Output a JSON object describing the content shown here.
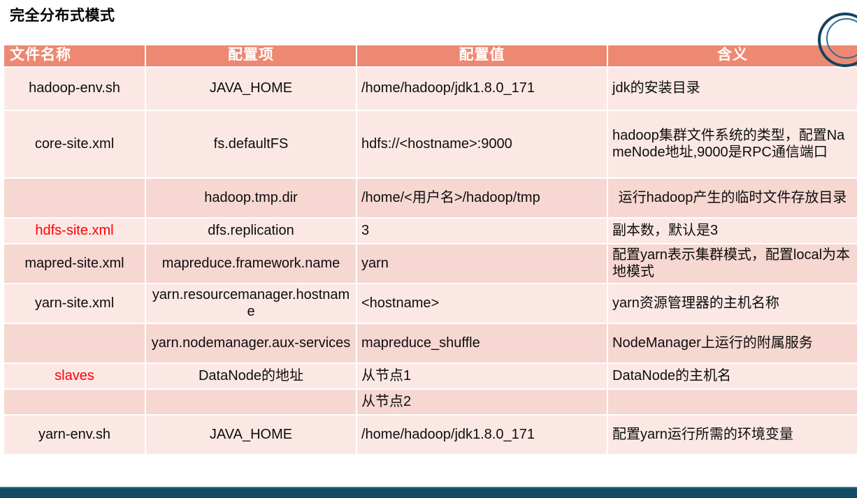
{
  "title": "完全分布式模式",
  "table": {
    "headers": [
      {
        "label": "文件名称",
        "align": "left"
      },
      {
        "label": "配置项",
        "align": "center"
      },
      {
        "label": "配置值",
        "align": "center"
      },
      {
        "label": "含义",
        "align": "center"
      }
    ],
    "rows": [
      {
        "shade": "a",
        "file": "hadoop-env.sh",
        "item": "JAVA_HOME",
        "value": "/home/hadoop/jdk1.8.0_171",
        "meaning": "jdk的安装目录",
        "file_red": false
      },
      {
        "shade": "a",
        "file": "core-site.xml",
        "item": "fs.defaultFS",
        "value": "hdfs://<hostname>:9000",
        "meaning": "hadoop集群文件系统的类型，配置NameNode地址,9000是RPC通信端口",
        "file_red": false
      },
      {
        "shade": "b",
        "file": "",
        "item": "hadoop.tmp.dir",
        "value": "/home/<用户名>/hadoop/tmp",
        "meaning": "运行hadoop产生的临时文件存放目录",
        "file_red": false
      },
      {
        "shade": "a",
        "file": "hdfs-site.xml",
        "item": "dfs.replication",
        "value": "3",
        "meaning": "副本数，默认是3",
        "file_red": true
      },
      {
        "shade": "b",
        "file": "mapred-site.xml",
        "item": "mapreduce.framework.name",
        "value": "yarn",
        "meaning": "配置yarn表示集群模式，配置local为本地模式",
        "file_red": false
      },
      {
        "shade": "a",
        "file": "yarn-site.xml",
        "item": "yarn.resourcemanager.hostname",
        "value": "<hostname>",
        "meaning": "yarn资源管理器的主机名称",
        "file_red": false
      },
      {
        "shade": "b",
        "file": "",
        "item": "yarn.nodemanager.aux-services",
        "value": "mapreduce_shuffle",
        "meaning": "NodeManager上运行的附属服务",
        "file_red": false
      },
      {
        "shade": "a",
        "file": "slaves",
        "item": "DataNode的地址",
        "value": "从节点1",
        "meaning": "DataNode的主机名",
        "file_red": true
      },
      {
        "shade": "b",
        "file": "",
        "item": "",
        "value": "从节点2",
        "meaning": "",
        "file_red": false
      },
      {
        "shade": "a",
        "file": "yarn-env.sh",
        "item": "JAVA_HOME",
        "value": "/home/hadoop/jdk1.8.0_171",
        "meaning": "配置yarn运行所需的环境变量",
        "file_red": false
      }
    ]
  },
  "colors": {
    "header_bg": "#ED8972",
    "row_light": "#FBE8E5",
    "row_dark": "#F6D7D1",
    "red_text": "#FF0000",
    "bottom_bar": "#134A63",
    "deco_arc": "#154360"
  }
}
